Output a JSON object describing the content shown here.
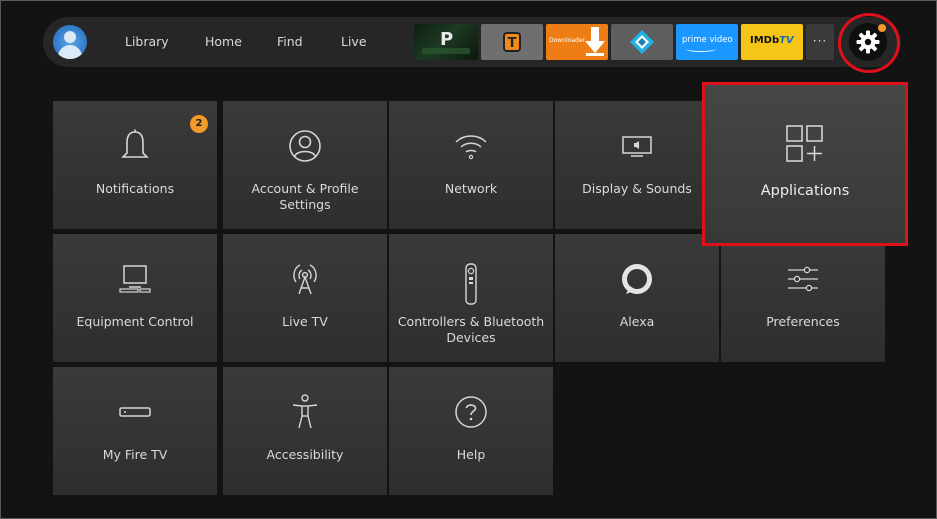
{
  "nav": {
    "items": [
      {
        "id": "library",
        "label": "Library"
      },
      {
        "id": "home",
        "label": "Home"
      },
      {
        "id": "find",
        "label": "Find"
      },
      {
        "id": "live",
        "label": "Live"
      }
    ]
  },
  "apps": {
    "t_letter": "T",
    "downloader_label": "Downloader",
    "prime_label": "prime video",
    "imdb_label": "IMDb",
    "imdb_tv": "TV",
    "more_label": "···",
    "notification_dot_color": "#f39a2b",
    "icons": [
      "plex-icon",
      "t-app-icon",
      "downloader-icon",
      "kodi-icon",
      "prime-video-icon",
      "imdb-tv-icon",
      "more-icon",
      "gear-icon"
    ]
  },
  "settings": {
    "focused": "Applications",
    "highlight_color": "#e0101b",
    "tiles": [
      {
        "id": "notifications",
        "label": "Notifications",
        "icon": "bell-icon",
        "badge": "2"
      },
      {
        "id": "account",
        "label": "Account & Profile Settings",
        "icon": "profile-icon"
      },
      {
        "id": "network",
        "label": "Network",
        "icon": "wifi-icon"
      },
      {
        "id": "display",
        "label": "Display & Sounds",
        "icon": "tv-sound-icon"
      },
      {
        "id": "applications",
        "label": "Applications",
        "icon": "apps-grid-icon"
      },
      {
        "id": "equipment",
        "label": "Equipment Control",
        "icon": "monitor-icon"
      },
      {
        "id": "livetv",
        "label": "Live TV",
        "icon": "antenna-icon"
      },
      {
        "id": "controllers",
        "label": "Controllers & Bluetooth Devices",
        "icon": "remote-icon"
      },
      {
        "id": "alexa",
        "label": "Alexa",
        "icon": "alexa-icon"
      },
      {
        "id": "preferences",
        "label": "Preferences",
        "icon": "sliders-icon"
      },
      {
        "id": "myfiretv",
        "label": "My Fire TV",
        "icon": "fire-tv-device-icon"
      },
      {
        "id": "accessibility",
        "label": "Accessibility",
        "icon": "accessibility-icon"
      },
      {
        "id": "help",
        "label": "Help",
        "icon": "help-icon"
      }
    ]
  }
}
